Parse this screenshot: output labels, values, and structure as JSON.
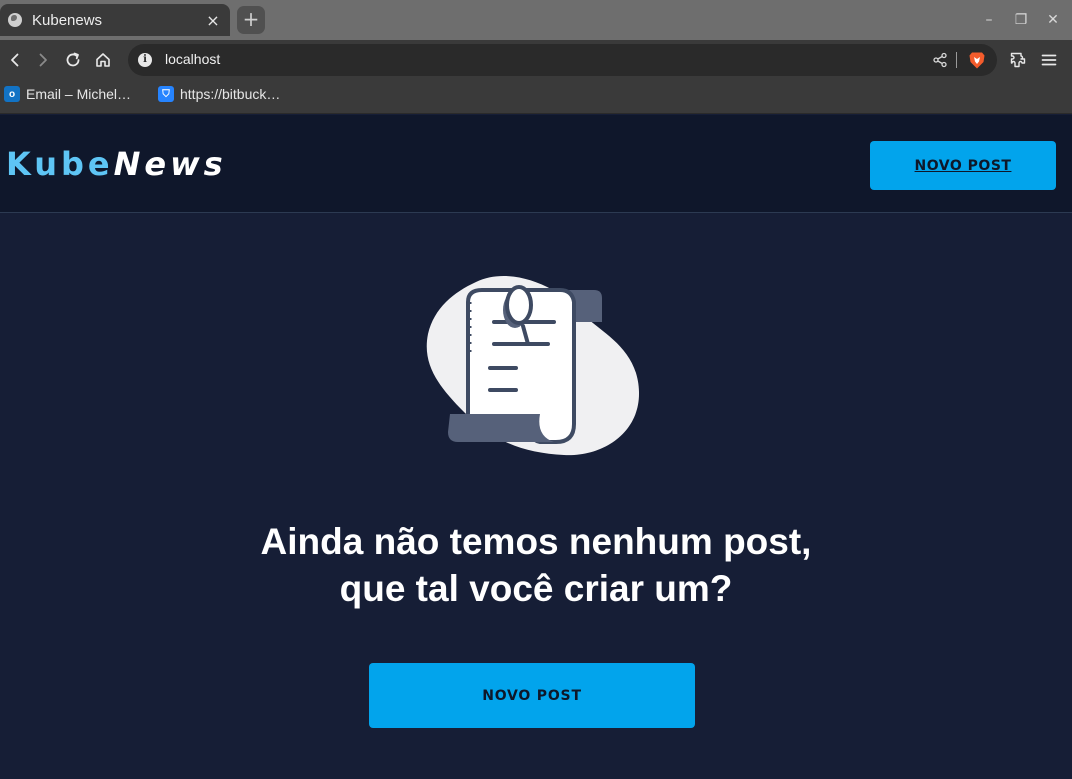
{
  "browser": {
    "tab": {
      "title": "Kubenews",
      "close_glyph": "×"
    },
    "new_tab_glyph": "+",
    "window_controls": {
      "minimize": "–",
      "restore": "❐",
      "close": "✕"
    },
    "address": {
      "url": "localhost",
      "info_glyph": "i"
    },
    "bookmarks": [
      {
        "label": "Email – Michel…",
        "icon": "outlook-icon",
        "icon_glyph": "o",
        "icon_color": "#1273c5"
      },
      {
        "label": "https://bitbuck…",
        "icon": "bitbucket-icon",
        "icon_glyph": "⛉",
        "icon_color": "#2684ff"
      }
    ]
  },
  "site": {
    "logo": {
      "part1": "Kube",
      "part2": "News"
    },
    "header_button": "NOVO POST",
    "empty_message": "Ainda não temos nenhum post, que tal você criar um?",
    "main_button": "NOVO POST"
  },
  "colors": {
    "accent": "#02a4ec",
    "logo_blue": "#5ec5f5",
    "page_bg": "#161e36",
    "header_bg": "#0f172b"
  }
}
